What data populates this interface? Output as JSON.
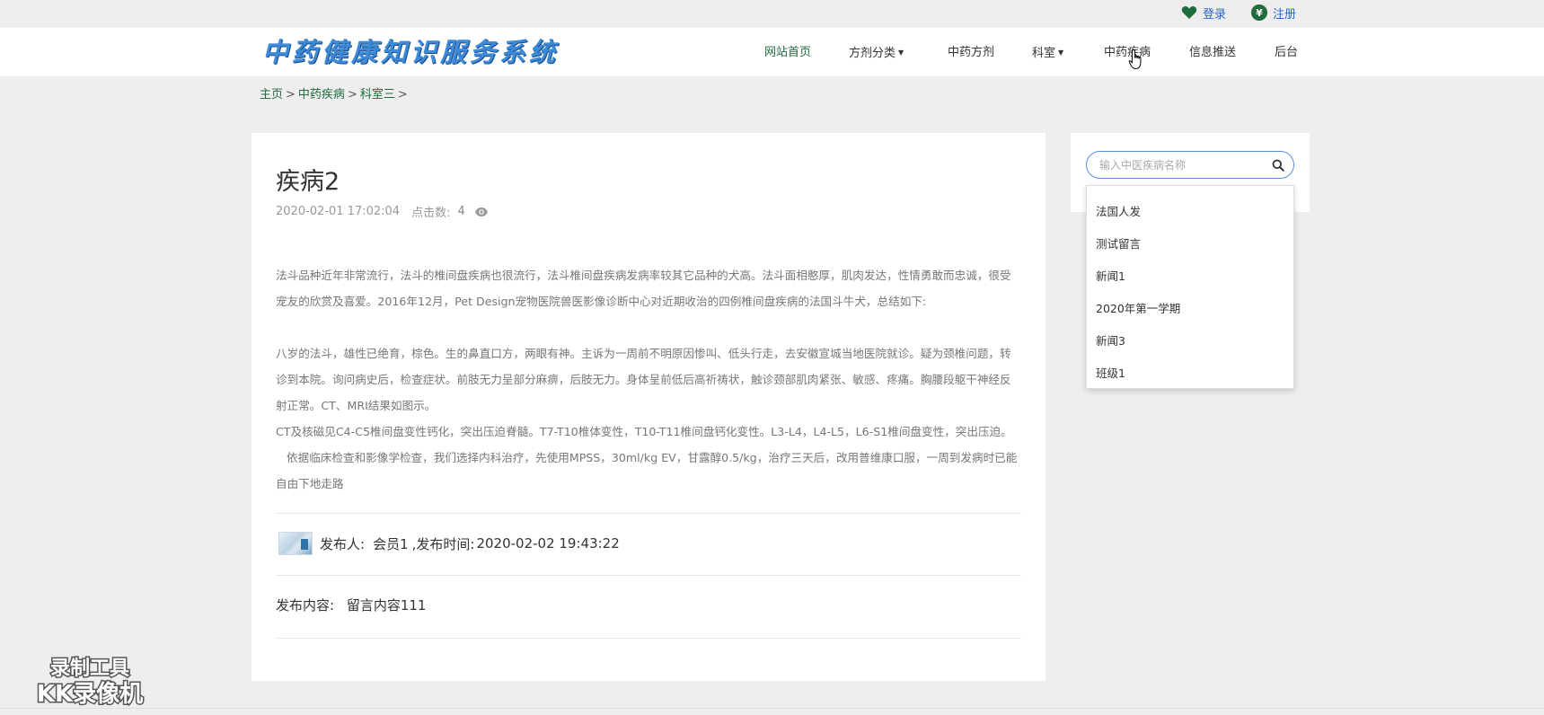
{
  "topbar": {
    "login_label": "登录",
    "register_label": "注册"
  },
  "header": {
    "logo_text": "中药健康知识服务系统",
    "nav": [
      {
        "label": "网站首页",
        "active": true
      },
      {
        "label": "方剂分类",
        "dropdown": true
      },
      {
        "label": "中药方剂"
      },
      {
        "label": "科室",
        "dropdown": true
      },
      {
        "label": "中药疾病"
      },
      {
        "label": "信息推送"
      },
      {
        "label": "后台"
      }
    ]
  },
  "breadcrumb": {
    "home": "主页",
    "section": "中药疾病",
    "current": "科室三",
    "separator": ">"
  },
  "article": {
    "title": "疾病2",
    "date": "2020-02-01 17:02:04",
    "clicks_label": "点击数:",
    "clicks": "4",
    "paragraphs": {
      "p1": "法斗品种近年非常流行，法斗的椎间盘疾病也很流行，法斗椎间盘疾病发病率较其它品种的犬高。法斗面相憨厚，肌肉发达，性情勇敢而忠诚，很受宠友的欣赏及喜爱。2016年12月，Pet Design宠物医院兽医影像诊断中心对近期收治的四例椎间盘疾病的法国斗牛犬，总结如下:",
      "p2": "八岁的法斗，雄性已绝育，棕色。生的鼻直口方，两眼有神。主诉为一周前不明原因惨叫、低头行走，去安徽宣城当地医院就诊。疑为颈椎问题，转诊到本院。询问病史后，检查症状。前肢无力呈部分麻痹，后肢无力。身体呈前低后高祈祷状，触诊颈部肌肉紧张、敏感、疼痛。胸腰段躯干神经反射正常。CT、MRI结果如图示。",
      "p3": "CT及核磁见C4-C5椎间盘变性钙化，突出压迫脊髓。T7-T10椎体变性，T10-T11椎间盘钙化变性。L3-L4，L4-L5，L6-S1椎间盘变性，突出压迫。",
      "p4": "依据临床检查和影像学检查，我们选择内科治疗，先使用MPSS，30ml/kg EV，甘露醇0.5/kg，治疗三天后，改用普维康口服，一周到发病时已能自由下地走路"
    }
  },
  "comment": {
    "publisher_label": "发布人:",
    "publisher": "会员1",
    "time_label": ",发布时间:",
    "time": "2020-02-02 19:43:22",
    "content_label": "发布内容:",
    "content": "留言内容111"
  },
  "search": {
    "placeholder": "输入中医疾病名称"
  },
  "suggestions": [
    "法国人发",
    "测试留言",
    "新闻1",
    "2020年第一学期",
    "新闻3",
    "班级1"
  ],
  "watermark": {
    "line1": "录制工具",
    "line2": "KK录像机"
  },
  "colors": {
    "accent_green": "#1f6b3b",
    "link_blue": "#2a66c8",
    "search_border": "#5b8dd6"
  }
}
